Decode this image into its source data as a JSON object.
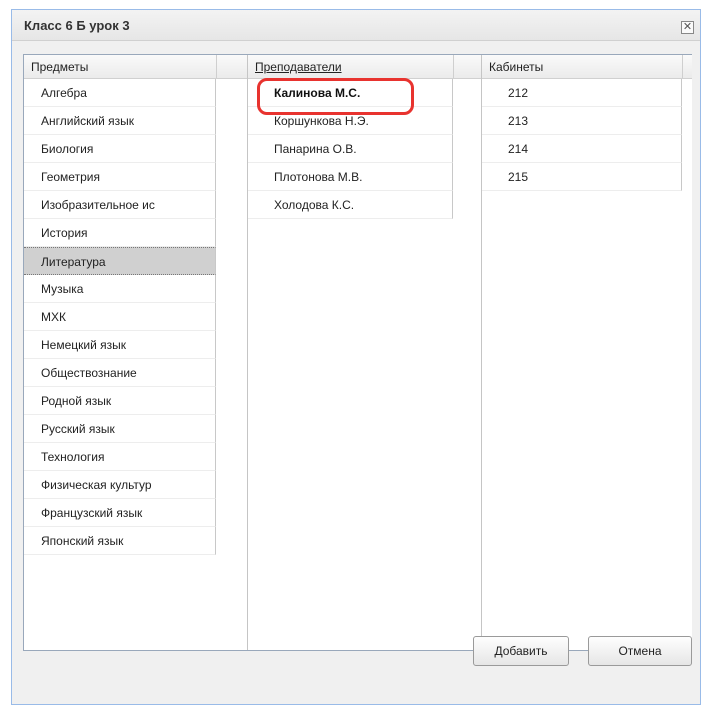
{
  "dialog": {
    "title": "Класс 6 Б урок 3",
    "close_glyph": "✕",
    "close_icon": "close-icon"
  },
  "columns": {
    "subjects": {
      "header": "Предметы",
      "items": [
        "Алгебра",
        "Английский язык",
        "Биология",
        "Геометрия",
        "Изобразительное ис",
        "История",
        "Литература",
        "Музыка",
        "МХК",
        "Немецкий язык",
        "Обществознание",
        "Родной язык",
        "Русский язык",
        "Технология",
        "Физическая культур",
        "Французский язык",
        "Японский язык"
      ],
      "selected": "Литература"
    },
    "teachers": {
      "header": "Преподаватели",
      "items": [
        "Калинова М.С.",
        "Коршункова Н.Э.",
        "Панарина О.В.",
        "Плотонова М.В.",
        "Холодова К.С."
      ],
      "bold": "Калинова М.С.",
      "highlight_color": "#e8332f"
    },
    "rooms": {
      "header": "Кабинеты",
      "items": [
        "212",
        "213",
        "214",
        "215"
      ]
    }
  },
  "buttons": {
    "add_label": "Добавить",
    "cancel_label": "Отмена"
  }
}
